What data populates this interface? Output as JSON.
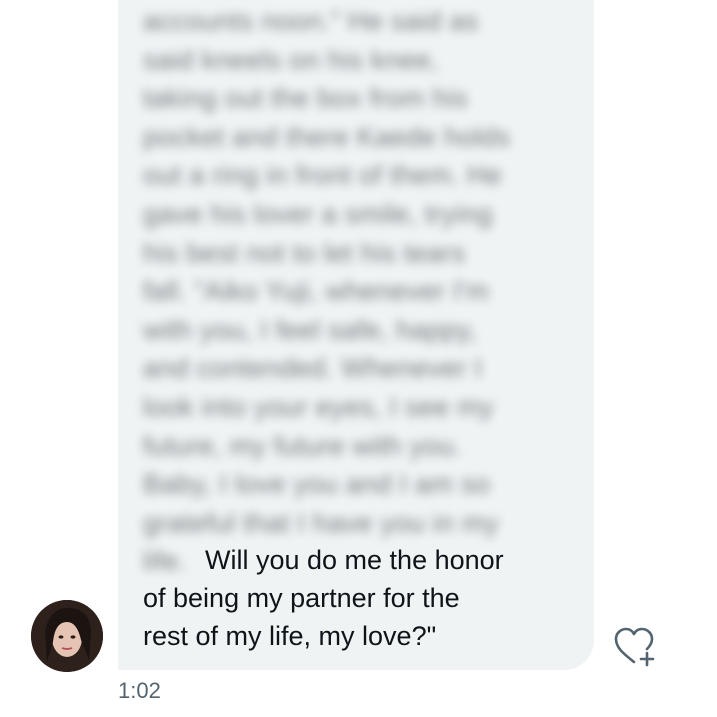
{
  "message": {
    "blurred_lines": [
      "accounts noon.\" He said as",
      "said kneels on his knee,",
      "taking out the box from his",
      "pocket and there Kaede holds",
      "out a ring in front of them. He",
      "gave his lover a smile, trying",
      "his best not to let his tears",
      "fall. \"Aiko Yuji, whenever I'm",
      "with you, I feel safe, happy,",
      "and contended. Whenever I",
      "look into your eyes, I see my",
      "future, my future with you.",
      "Baby, I love you and I am so",
      "grateful that I have you in my",
      "life."
    ],
    "visible_lines": [
      "Will you do me the honor",
      "of being my partner for the",
      "rest of my life, my love?\""
    ],
    "timestamp": "1:02"
  },
  "sender": {
    "avatar_icon": "user-avatar"
  },
  "reaction": {
    "icon": "heart-plus-icon"
  },
  "colors": {
    "bubble": "#eff3f4",
    "text": "#0f1419",
    "timestamp": "#536471"
  }
}
